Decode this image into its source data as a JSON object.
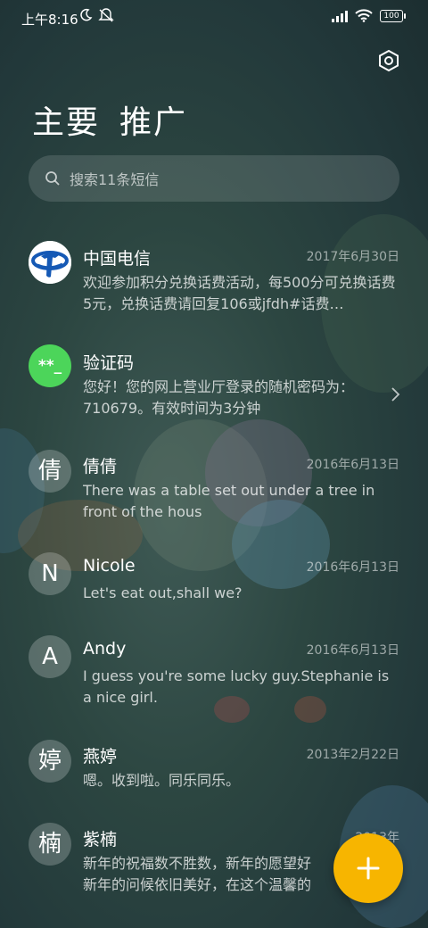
{
  "status_bar": {
    "time": "上午8:16",
    "battery": "100"
  },
  "header": {
    "tab_main": "主要",
    "tab_promo": "推广"
  },
  "search": {
    "placeholder": "搜索11条短信"
  },
  "conversations": [
    {
      "name": "中国电信",
      "date": "2017年6月30日",
      "preview": "欢迎参加积分兑换话费活动，每500分可兑换话费5元，兑换话费请回复106或jfdh#话费…",
      "avatar": "telecom-logo"
    },
    {
      "name": "验证码",
      "date": "",
      "preview": "您好！您的网上营业厅登录的随机密码为：710679。有效时间为3分钟",
      "avatar_text": "**_"
    },
    {
      "name": "倩倩",
      "date": "2016年6月13日",
      "preview": "There was a table set out under a tree in front of the hous",
      "avatar_text": "倩"
    },
    {
      "name": "Nicole",
      "date": "2016年6月13日",
      "preview": "Let's eat out,shall we?",
      "avatar_text": "N"
    },
    {
      "name": "Andy",
      "date": "2016年6月13日",
      "preview": "I guess you're some lucky guy.Stephanie is a nice girl.",
      "avatar_text": "A"
    },
    {
      "name": "燕婷",
      "date": "2013年2月22日",
      "preview": "嗯。收到啦。同乐同乐。",
      "avatar_text": "婷"
    },
    {
      "name": "紫楠",
      "date": "2013年",
      "preview": "新年的祝福数不胜数，新年的愿望好\n新年的问候依旧美好，在这个温馨的",
      "avatar_text": "楠"
    }
  ],
  "colors": {
    "fab": "#f7b500",
    "verification_avatar": "#4cd55a",
    "telecom_blue": "#1559b5"
  }
}
